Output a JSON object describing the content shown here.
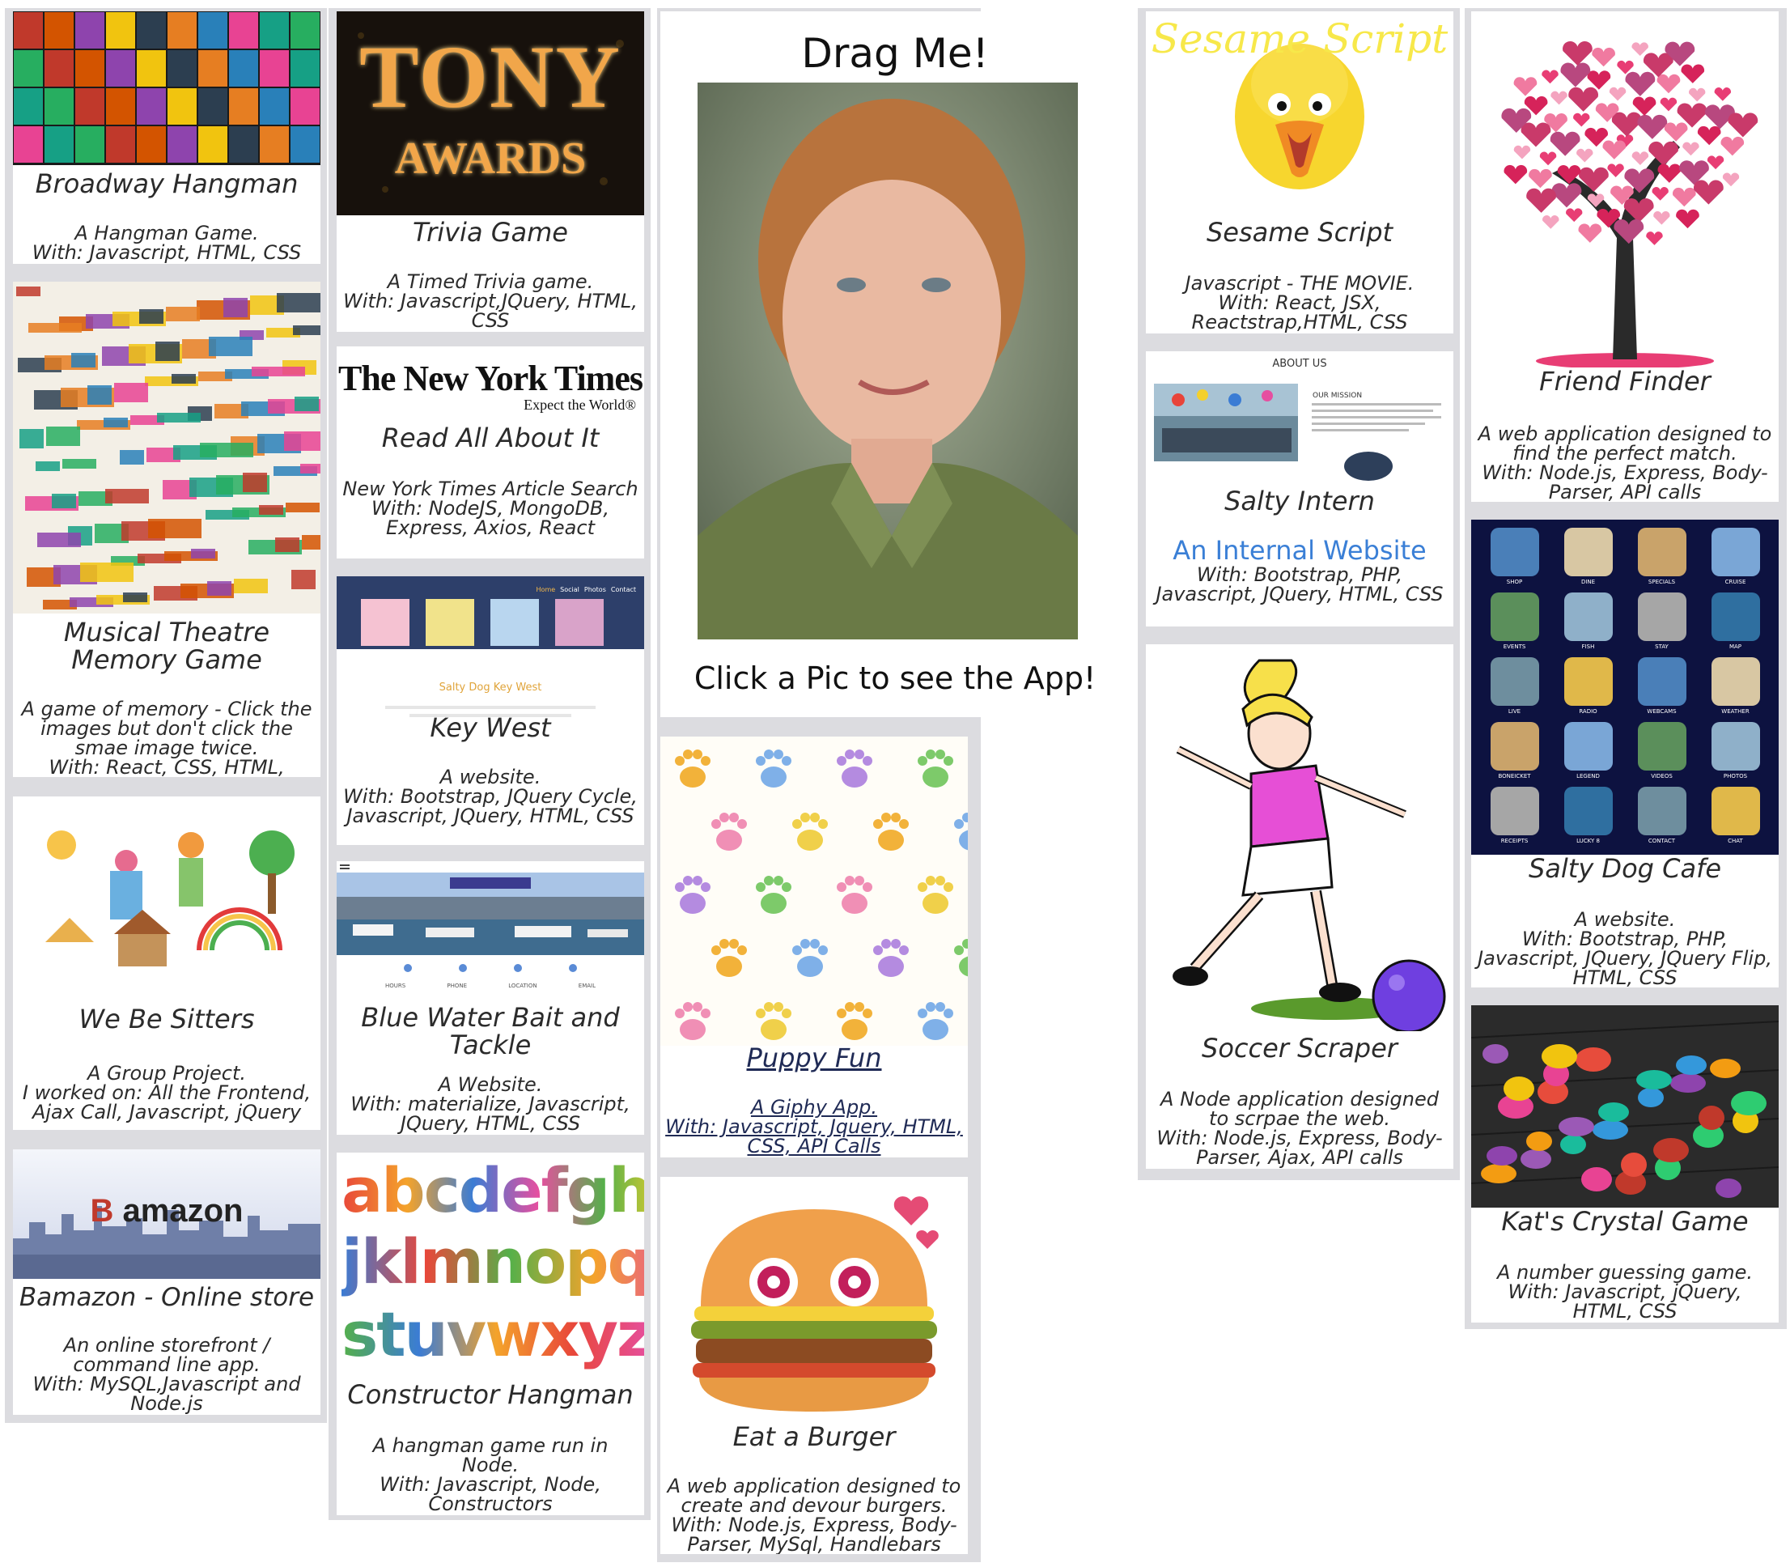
{
  "cards": {
    "hangman": {
      "title": "Broadway Hangman",
      "line1": "A Hangman Game.",
      "line2": "With: Javascript, HTML, CSS"
    },
    "musical": {
      "title": "Musical Theatre Memory Game",
      "line1": "A game of memory - Click the images but don't click the smae image twice.",
      "line2": "With: React, CSS, HTML,"
    },
    "sitters": {
      "title": "We Be Sitters",
      "line1": "A Group Project.",
      "line2": "I worked on: All the Frontend, Ajax Call, Javascript, jQuery"
    },
    "bamazon": {
      "title": "Bamazon - Online store",
      "line1": "An online storefront / command line app.",
      "line2": "With: MySQL,Javascript and Node.js",
      "logo_b": "B",
      "logo_text": "amazon"
    },
    "trivia": {
      "title": "Trivia Game",
      "line1": "A Timed Trivia game.",
      "line2": "With: Javascript,JQuery, HTML, CSS",
      "logo_1": "TONY",
      "logo_2": "AWARDS"
    },
    "nyt": {
      "title": "Read All About It",
      "line1": "New York Times Article Search",
      "line2": "With: NodeJS, MongoDB, Express, Axios, React",
      "logo": "The New York Times",
      "tagline": "Expect the World®"
    },
    "keywest": {
      "title": "Key West",
      "line1": "A website.",
      "line2": "With: Bootstrap, JQuery Cycle, Javascript, JQuery, HTML, CSS",
      "site_name": "Salty Dog Key West",
      "nav": [
        "Home",
        "Social",
        "Photos",
        "Contact"
      ]
    },
    "bluewater": {
      "title": "Blue Water Bait and Tackle",
      "line1": "A Website.",
      "line2": "With: materialize, Javascript, JQuery, HTML, CSS",
      "info": [
        "HOURS",
        "PHONE",
        "LOCATION",
        "EMAIL"
      ]
    },
    "constructor": {
      "title": "Constructor Hangman",
      "line1": "A hangman game run in Node.",
      "line2": "With: Javascript, Node, Constructors",
      "rows": [
        "abcdefghi",
        "jklmnopqr",
        "stuvwxyz"
      ]
    },
    "dragme": {
      "heading": "Drag Me!",
      "footer": "Click a Pic to see the App!"
    },
    "puppy": {
      "title": "Puppy Fun",
      "line1": "A Giphy App.",
      "line2": "With: Javascript, Jquery, HTML, CSS, API Calls"
    },
    "burger": {
      "title": "Eat a Burger",
      "line1": "A web application designed to create and devour burgers.",
      "line2": "With: Node.js, Express, Body-Parser, MySql, Handlebars"
    },
    "sesame": {
      "title": "Sesame Script",
      "line1": "Javascript - THE MOVIE.",
      "line2": "With: React, JSX, Reactstrap,HTML, CSS",
      "banner": "Sesame Script"
    },
    "salty_intern": {
      "title": "Salty Intern",
      "link": "An Internal Website",
      "line2": "With: Bootstrap, PHP, Javascript, JQuery, HTML, CSS",
      "about": "ABOUT US",
      "mission": "OUR MISSION"
    },
    "soccer": {
      "title": "Soccer Scraper",
      "line1": "A Node application designed to scrpae the web.",
      "line2": "With: Node.js, Express, Body-Parser, Ajax, API calls"
    },
    "friend": {
      "title": "Friend Finder",
      "line1": "A web application designed to find the perfect match.",
      "line2": "With: Node.js, Express, Body-Parser, API calls"
    },
    "saltydog_cafe": {
      "title": "Salty Dog Cafe",
      "line1": "A website.",
      "line2": "With: Bootstrap, PHP, Javascript, JQuery, JQuery Flip, HTML, CSS",
      "tiles": [
        "SHOP",
        "DINE",
        "SPECIALS",
        "CRUISE",
        "EVENTS",
        "FISH",
        "STAY",
        "MAP",
        "LIVE",
        "RADIO",
        "WEBCAMS",
        "WEATHER",
        "BONEICKET",
        "LEGEND",
        "VIDEOS",
        "PHOTOS",
        "RECEIPTS",
        "LUCKY 8",
        "CONTACT",
        "CHAT"
      ]
    },
    "crystal": {
      "title": "Kat's Crystal Game",
      "line1": "A number guessing game.",
      "line2": "With: Javascript, jQuery, HTML, CSS"
    }
  },
  "colors": {
    "gutter": "#dcdce0",
    "text": "#2b2b2b",
    "link_blue": "#3a7fd6",
    "sesame_yellow": "#f7e84a",
    "nyt_black": "#111111",
    "cafe_navy": "#0d1240"
  }
}
